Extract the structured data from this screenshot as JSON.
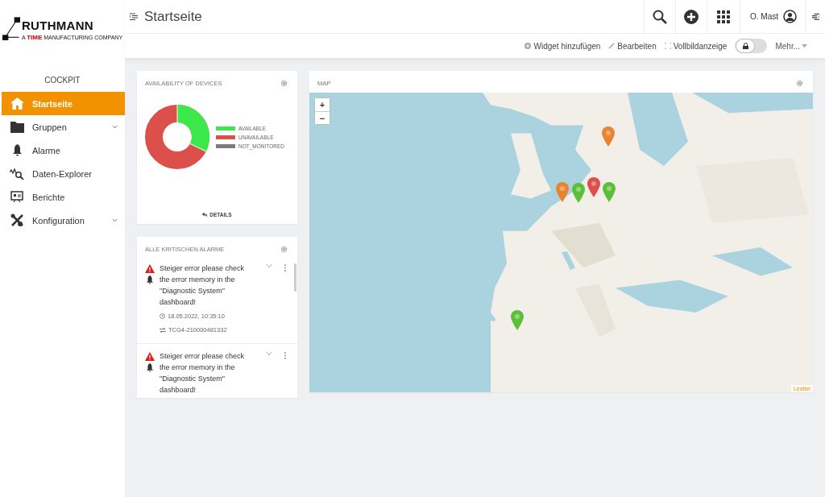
{
  "brand": {
    "name": "RUTHMANN",
    "tagline_prefix": "A",
    "tagline_brand": "TIME",
    "tagline_rest": "MANUFACTURING COMPANY"
  },
  "header": {
    "title": "Startseite",
    "user": "O. Mast"
  },
  "action_bar": {
    "items": [
      {
        "kind": "add",
        "label": "Widget hinzufügen"
      },
      {
        "kind": "edit",
        "label": "Bearbeiten"
      },
      {
        "kind": "fullscreen",
        "label": "Vollbildanzeige"
      }
    ],
    "lock": {
      "on": false
    },
    "more": "Mehr..."
  },
  "sidebar": {
    "heading": "COCKPIT",
    "items": [
      {
        "kind": "home",
        "label": "Startseite",
        "selected": true,
        "expandable": false
      },
      {
        "kind": "folder",
        "label": "Gruppen",
        "selected": false,
        "expandable": true
      },
      {
        "kind": "bell",
        "label": "Alarme",
        "selected": false,
        "expandable": false
      },
      {
        "kind": "explorer",
        "label": "Daten-Explorer",
        "selected": false,
        "expandable": false
      },
      {
        "kind": "report",
        "label": "Berichte",
        "selected": false,
        "expandable": false
      },
      {
        "kind": "tools",
        "label": "Konfiguration",
        "selected": false,
        "expandable": true
      }
    ]
  },
  "availability": {
    "title": "AVAILABILITY OF DEVICES",
    "legend": [
      {
        "label": "AVAILABLE",
        "color": "#3de84b"
      },
      {
        "label": "UNAVAILABLE",
        "color": "#dc504c"
      },
      {
        "label": "NOT_MONITORED",
        "color": "#7c7c7c"
      }
    ],
    "details": "DETAILS"
  },
  "alarms": {
    "title": "ALLE KRITISCHEN ALARME",
    "items": [
      {
        "text": "Steiger error please check the error memory in the \"Diagnostic System\" dashboard!",
        "time": "18.05.2022, 10:35:10",
        "device": "TCG4-210000481332"
      },
      {
        "text": "Steiger error please check the error memory in the \"Diagnostic System\" dashboard!"
      }
    ]
  },
  "map": {
    "title": "MAP",
    "zoom_in": "+",
    "zoom_out": "−",
    "attribution": "Leaflet",
    "markers": [
      {
        "color": "#e8832f"
      },
      {
        "color": "#e8832f"
      },
      {
        "color": "#dc504c"
      },
      {
        "color": "#5cbf3a"
      },
      {
        "color": "#5cbf3a"
      },
      {
        "color": "#5cbf3a"
      }
    ]
  }
}
